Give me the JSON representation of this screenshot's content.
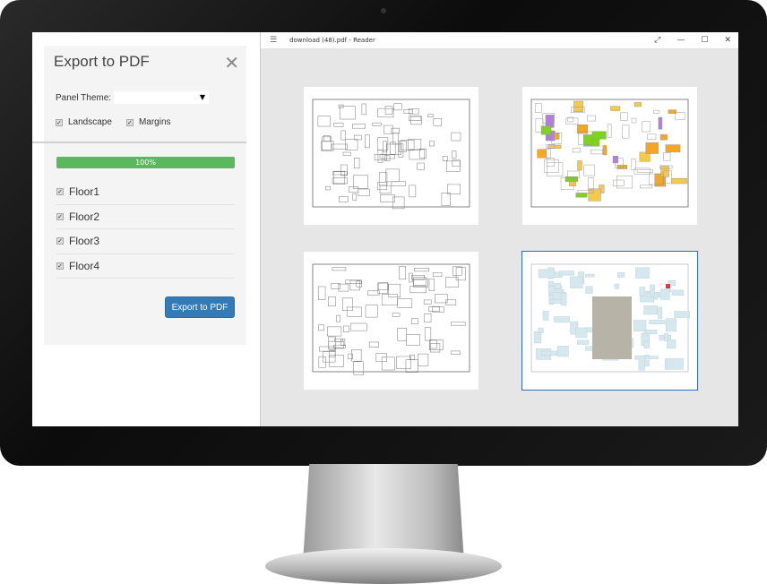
{
  "dialog": {
    "title": "Export to PDF",
    "close_icon": "close-icon",
    "panel_theme_label": "Panel Theme:",
    "panel_theme_value": "",
    "landscape_label": "Landscape",
    "landscape_checked": true,
    "margins_label": "Margins",
    "margins_checked": true,
    "progress_percent": 100,
    "progress_label": "100%",
    "floors": [
      {
        "label": "Floor1",
        "checked": true
      },
      {
        "label": "Floor2",
        "checked": true
      },
      {
        "label": "Floor3",
        "checked": true
      },
      {
        "label": "Floor4",
        "checked": true
      }
    ],
    "export_button": "Export to PDF"
  },
  "reader": {
    "title": "download (48).pdf - Reader",
    "menu_icon": "hamburger-icon",
    "controls": [
      "expand-icon",
      "minimize-icon",
      "maximize-icon",
      "close-icon"
    ],
    "pages": 4,
    "selected_page": 4
  },
  "colors": {
    "progress": "#5cb85c",
    "button": "#337ab7",
    "selection": "#2b6cc4"
  }
}
